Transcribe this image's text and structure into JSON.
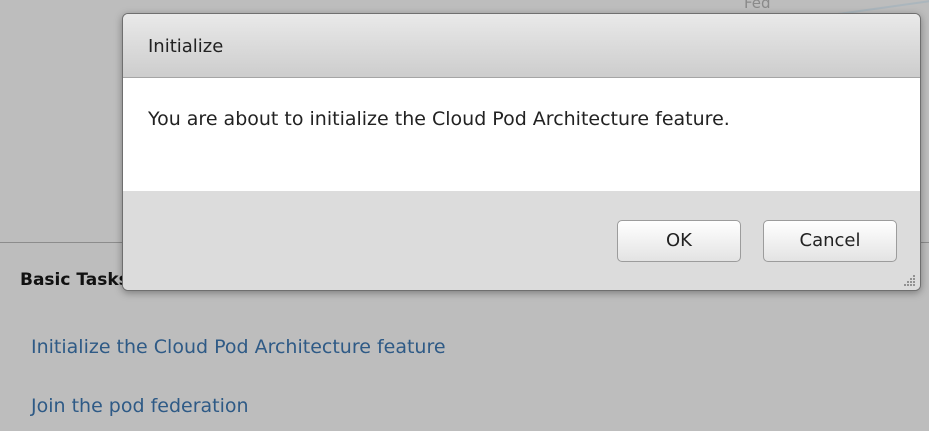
{
  "background": {
    "diagram_fragment_text": "Fed",
    "section_heading": "Basic Tasks",
    "links": [
      "Initialize the Cloud Pod Architecture feature",
      "Join the pod federation"
    ]
  },
  "dialog": {
    "title": "Initialize",
    "message": "You are about to initialize the Cloud Pod Architecture feature.",
    "ok_label": "OK",
    "cancel_label": "Cancel"
  },
  "icons": {
    "resize_grip": "resize-grip-icon"
  }
}
